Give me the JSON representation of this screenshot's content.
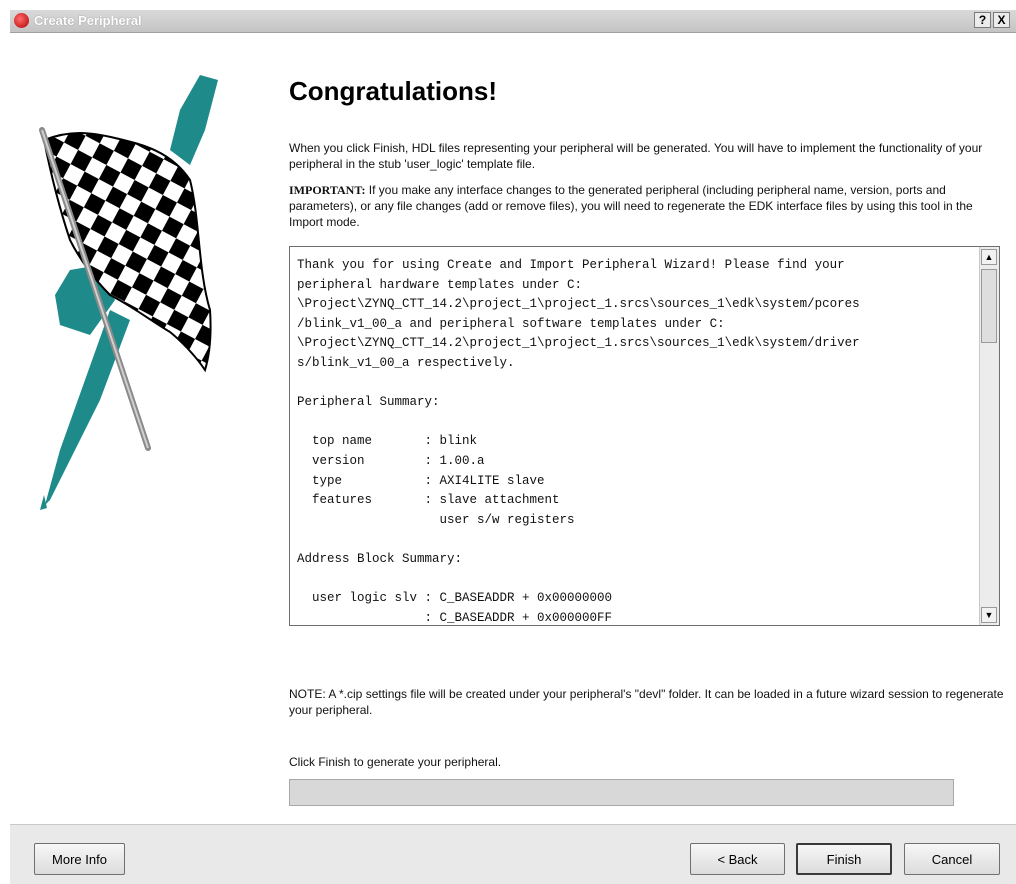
{
  "window": {
    "title": "Create Peripheral",
    "help_label": "?",
    "close_label": "X"
  },
  "content": {
    "heading": "Congratulations!",
    "intro": "When you click Finish, HDL files representing your peripheral will be generated. You will have to implement the functionality of your peripheral in the stub 'user_logic' template file.",
    "important_label": "IMPORTANT:",
    "important_text": " If you make any interface changes to the generated peripheral (including peripheral name, version, ports and parameters), or any file changes (add or remove files), you will need to regenerate the EDK interface files by using this tool in the Import mode.",
    "summary_lines": [
      "Thank you for using Create and Import Peripheral Wizard! Please find your",
      "peripheral hardware templates under C:",
      "\\Project\\ZYNQ_CTT_14.2\\project_1\\project_1.srcs\\sources_1\\edk\\system/pcores",
      "/blink_v1_00_a and peripheral software templates under C:",
      "\\Project\\ZYNQ_CTT_14.2\\project_1\\project_1.srcs\\sources_1\\edk\\system/driver",
      "s/blink_v1_00_a respectively.",
      "",
      "Peripheral Summary:",
      "",
      "  top name       : blink",
      "  version        : 1.00.a",
      "  type           : AXI4LITE slave",
      "  features       : slave attachment",
      "                   user s/w registers",
      "",
      "Address Block Summary:",
      "",
      "  user logic slv : C_BASEADDR + 0x00000000",
      "                 : C_BASEADDR + 0x000000FF"
    ],
    "note": "NOTE: A *.cip settings file will be created under your peripheral's \"devl\" folder. It can be loaded in a future  wizard session to regenerate your peripheral.",
    "finish_prompt": "Click Finish to generate your peripheral.",
    "progress": 0
  },
  "buttons": {
    "more_info": "More Info",
    "back": "< Back",
    "finish": "Finish",
    "cancel": "Cancel"
  },
  "icons": {
    "app": "app-icon",
    "flag": "checkered-flag-icon",
    "scroll_up": "scroll-up-icon",
    "scroll_down": "scroll-down-icon"
  },
  "colors": {
    "flag_teal": "#1e8a8a"
  }
}
